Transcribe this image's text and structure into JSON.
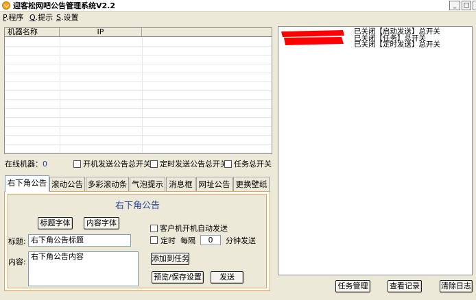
{
  "window": {
    "title": "迎客松网吧公告管理系统V2.2",
    "minimize": "_",
    "maximize": "□",
    "close": "×"
  },
  "menu": [
    {
      "key": "P",
      "label": ".程序"
    },
    {
      "key": "Q",
      "label": ".提示"
    },
    {
      "key": "S",
      "label": ".设置"
    }
  ],
  "table": {
    "columns": [
      "机器名称",
      "IP"
    ]
  },
  "status": {
    "online_label": "在线机器：",
    "online_count": "0",
    "switch_boot": "开机发送公告总开关",
    "switch_timer": "定时发送公告总开关",
    "switch_task": "任务总开关"
  },
  "tabs": [
    "右下角公告",
    "滚动公告",
    "多彩滚动条",
    "气泡提示",
    "消息框",
    "网址公告",
    "更换壁纸"
  ],
  "panel": {
    "title": "右下角公告",
    "title_font_button": "标题字体",
    "content_font_button": "内容字体",
    "title_label": "标题:",
    "title_value": "右下角公告标题",
    "content_label": "内容:",
    "content_value": "右下角公告内容",
    "auto_send_label": "客户机开机自动发送",
    "timer_label": "定时",
    "every_label": "每隔",
    "interval_value": "0",
    "minutes_label": "分钟发送",
    "add_task_button": "添加到任务",
    "preview_button": "预览/保存设置",
    "send_button": "发送"
  },
  "log": {
    "lines": [
      "已关闭【启动发送】总开关",
      "已关闭【任务】总开关",
      "已关闭【定时发送】总开关"
    ],
    "redact_color": "#ff0000"
  },
  "bottom_buttons": {
    "task_manage": "任务管理",
    "view_records": "查看记录",
    "clear_log": "清除日志"
  }
}
